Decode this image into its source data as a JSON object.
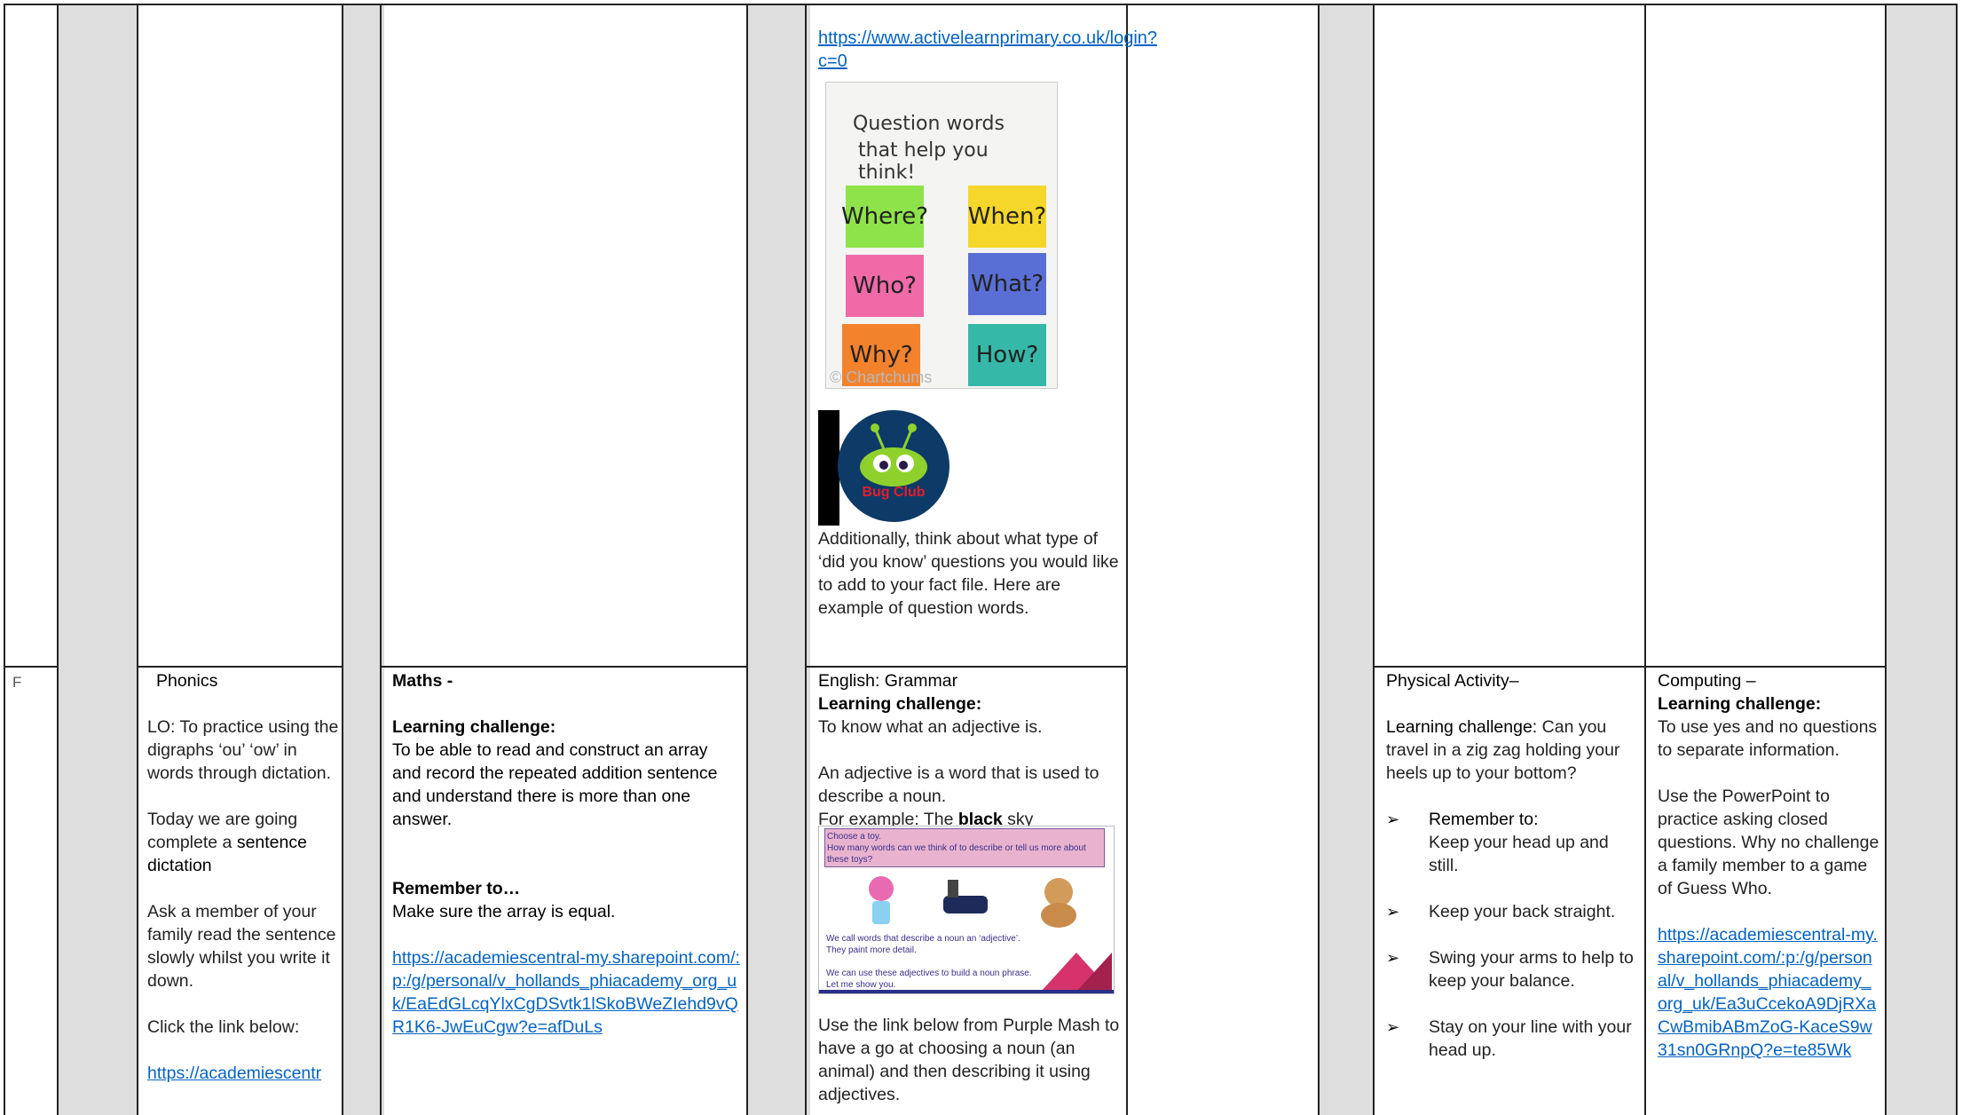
{
  "row_label": "F",
  "top": {
    "english": {
      "link": "https://www.activelearnprimary.co.uk/login?c=0",
      "question_image": {
        "title_line1": "Question words",
        "title_line2": "that help you think!",
        "words": [
          "Where?",
          "When?",
          "Who?",
          "What?",
          "Why?",
          "How?"
        ],
        "colors": [
          "#8fe34a",
          "#f5d62b",
          "#f06aa8",
          "#5a6fd6",
          "#f3822d",
          "#35b8a8"
        ],
        "watermark": "© Chartchums"
      },
      "bug_club_label": "Bug Club",
      "note": "Additionally, think about what type of ‘did you know’ questions you would like to add to your fact file. Here are example of question words."
    }
  },
  "phonics": {
    "title": "Phonics",
    "lo": "LO: To practice using the digraphs ‘ou’ ‘ow’ in words through dictation.",
    "today_prefix": "Today we are going complete a ",
    "today_bold": "sentence dictation",
    "ask": "Ask a member of your family read the sentence slowly whilst you write it down.",
    "click": "Click the link below:",
    "link": "https://academiescentr"
  },
  "maths": {
    "title": "Maths -",
    "challenge_label": "Learning challenge:",
    "challenge": "To be able to read and construct an array and record the repeated addition sentence and understand there is more than one answer.",
    "remember_label": "Remember to…",
    "remember": "Make sure the array is equal.",
    "link": "https://academiescentral-my.sharepoint.com/:p:/g/personal/v_hollands_phiacademy_org_uk/EaEdGLcqYlxCgDSvtk1lSkoBWeZIehd9vQR1K6-JwEuCgw?e=afDuLs"
  },
  "english_grammar": {
    "title": "English: Grammar",
    "challenge_label": "Learning challenge:",
    "challenge": "To know what an adjective is.",
    "definition": "An adjective is a word that is used to describe a noun.",
    "example_prefix": "For example: The ",
    "example_bold": "black",
    "example_suffix": " sky",
    "slide": {
      "line1": "Choose a toy.",
      "line2": "How many words can we think of to describe or tell us more about these toys?",
      "line3": "We call words that describe a noun an ‘adjective’.",
      "line4": "They paint more detail.",
      "line5": "We can use these adjectives to build a noun phrase.",
      "line6": "Let me show you."
    },
    "purple_mash": "Use the link below from Purple Mash to have a go at choosing a noun (an animal) and then describing it using adjectives."
  },
  "physical": {
    "title": "Physical Activity–",
    "challenge_label": "Learning challenge:",
    "challenge": " Can you travel in a zig zag holding your heels up to your bottom?",
    "remember_label": "Remember to:",
    "items": [
      "Keep your head up and still.",
      "Keep your back straight.",
      "Swing your arms to help to keep your balance.",
      "Stay on your line with your head up."
    ]
  },
  "computing": {
    "title": "Computing  –",
    "challenge_label": "Learning challenge:",
    "challenge": "To use yes and no questions to separate information.",
    "body": "Use the PowerPoint to practice asking closed questions. Why no challenge a family member to a game of Guess Who.",
    "link": "https://academiescentral-my.sharepoint.com/:p:/g/personal/v_hollands_phiacademy_org_uk/Ea3uCcekoA9DjRXaCwBmibABmZoG-KaceS9w31sn0GRnpQ?e=te85Wk"
  }
}
